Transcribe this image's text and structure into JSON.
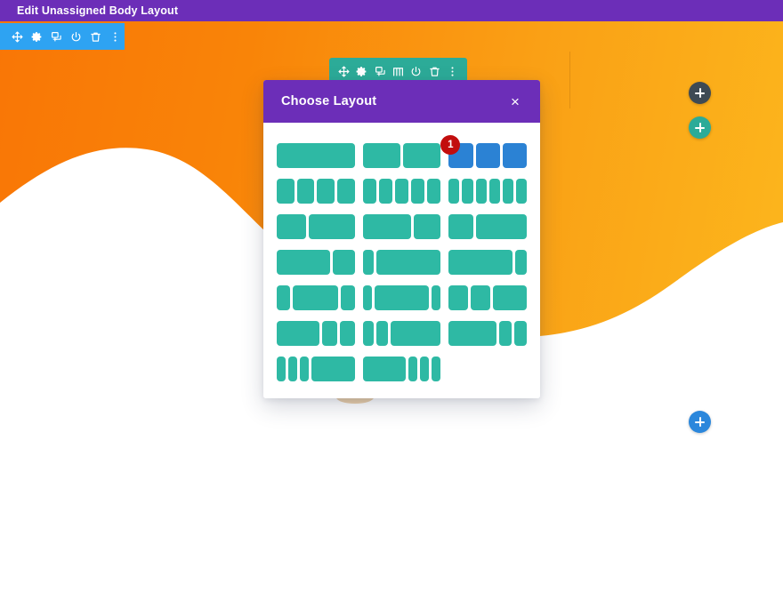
{
  "admin_bar": {
    "title": "Edit Unassigned Body Layout",
    "bg_color": "#6C2EB8"
  },
  "section_toolbar": {
    "bg_color": "#2EA3F2",
    "buttons": [
      {
        "name": "move-icon",
        "title": "Move Section"
      },
      {
        "name": "gear-icon",
        "title": "Section Settings"
      },
      {
        "name": "duplicate-icon",
        "title": "Duplicate Section"
      },
      {
        "name": "power-icon",
        "title": "Disable Section"
      },
      {
        "name": "trash-icon",
        "title": "Delete Section"
      },
      {
        "name": "more-options-icon",
        "title": "More Options"
      }
    ]
  },
  "row_toolbar": {
    "bg_color": "#2CAB98",
    "buttons": [
      {
        "name": "move-icon",
        "title": "Move Row"
      },
      {
        "name": "gear-icon",
        "title": "Row Settings"
      },
      {
        "name": "duplicate-icon",
        "title": "Duplicate Row"
      },
      {
        "name": "columns-icon",
        "title": "Change Column Structure",
        "active": true
      },
      {
        "name": "power-icon",
        "title": "Disable Row"
      },
      {
        "name": "trash-icon",
        "title": "Delete Row"
      },
      {
        "name": "more-options-icon",
        "title": "More Options"
      }
    ]
  },
  "modal": {
    "title": "Choose Layout",
    "close_label": "×",
    "header_color": "#6C2EB8",
    "column_color": "#2EB9A4",
    "hover_color": "#2B82D4",
    "badge_color": "#C20D0D",
    "badge_label": "1",
    "layouts": [
      {
        "name": "layout-1-column",
        "columns": [
          1
        ],
        "hovered": false,
        "badge": null
      },
      {
        "name": "layout-2-columns",
        "columns": [
          1,
          1
        ],
        "hovered": false,
        "badge": null
      },
      {
        "name": "layout-3-columns",
        "columns": [
          1,
          1,
          1
        ],
        "hovered": true,
        "badge": "1"
      },
      {
        "name": "layout-4-columns",
        "columns": [
          1,
          1,
          1,
          1
        ],
        "hovered": false,
        "badge": null
      },
      {
        "name": "layout-5-columns",
        "columns": [
          1,
          1,
          1,
          1,
          1
        ],
        "hovered": false,
        "badge": null
      },
      {
        "name": "layout-6-columns",
        "columns": [
          1,
          1,
          1,
          1,
          1,
          1
        ],
        "hovered": false,
        "badge": null
      },
      {
        "name": "layout-third-twothirds",
        "columns": [
          1,
          1.6
        ],
        "hovered": false,
        "badge": null
      },
      {
        "name": "layout-twothirds-third",
        "columns": [
          1.8,
          1
        ],
        "hovered": false,
        "badge": null
      },
      {
        "name": "layout-quarter-threequarter",
        "columns": [
          1,
          2.1
        ],
        "hovered": false,
        "badge": null
      },
      {
        "name": "layout-threequarter-quarter",
        "columns": [
          2.4,
          1
        ],
        "hovered": false,
        "badge": null
      },
      {
        "name": "layout-narrow-wide",
        "columns": [
          0.45,
          2.6
        ],
        "hovered": false,
        "badge": null
      },
      {
        "name": "layout-wide-narrow",
        "columns": [
          3,
          0.55
        ],
        "hovered": false,
        "badge": null
      },
      {
        "name": "layout-narrow-wide-narrow",
        "columns": [
          0.6,
          2,
          0.6
        ],
        "hovered": false,
        "badge": null
      },
      {
        "name": "layout-thin-wide-thin",
        "columns": [
          0.4,
          2.4,
          0.4
        ],
        "hovered": false,
        "badge": null
      },
      {
        "name": "layout-equal-equal-wide",
        "columns": [
          1,
          1,
          1.7
        ],
        "hovered": false,
        "badge": null
      },
      {
        "name": "layout-wide-two-narrow",
        "columns": [
          2,
          0.7,
          0.7
        ],
        "hovered": false,
        "badge": null
      },
      {
        "name": "layout-two-narrow-wide",
        "columns": [
          0.55,
          0.55,
          2.4
        ],
        "hovered": false,
        "badge": null
      },
      {
        "name": "layout-wide-narrow-narrow",
        "columns": [
          2.3,
          0.6,
          0.6
        ],
        "hovered": false,
        "badge": null
      },
      {
        "name": "layout-three-thin-wide",
        "columns": [
          0.4,
          0.4,
          0.4,
          1.9
        ],
        "hovered": false,
        "badge": null
      },
      {
        "name": "layout-wide-three-thin",
        "columns": [
          1.9,
          0.4,
          0.4,
          0.4
        ],
        "hovered": false,
        "badge": null
      }
    ]
  },
  "page_buttons": [
    {
      "name": "add-new-section-button",
      "label": "+",
      "color": "#3E4A54"
    },
    {
      "name": "add-new-row-button",
      "label": "+",
      "color": "#2CAB98"
    },
    {
      "name": "add-section-bottom-button",
      "label": "+",
      "color": "#2B87DC"
    }
  ],
  "background": {
    "gradient_from": "#F97606",
    "gradient_to": "#FCB71D",
    "wave_color": "#FFFFFF"
  }
}
